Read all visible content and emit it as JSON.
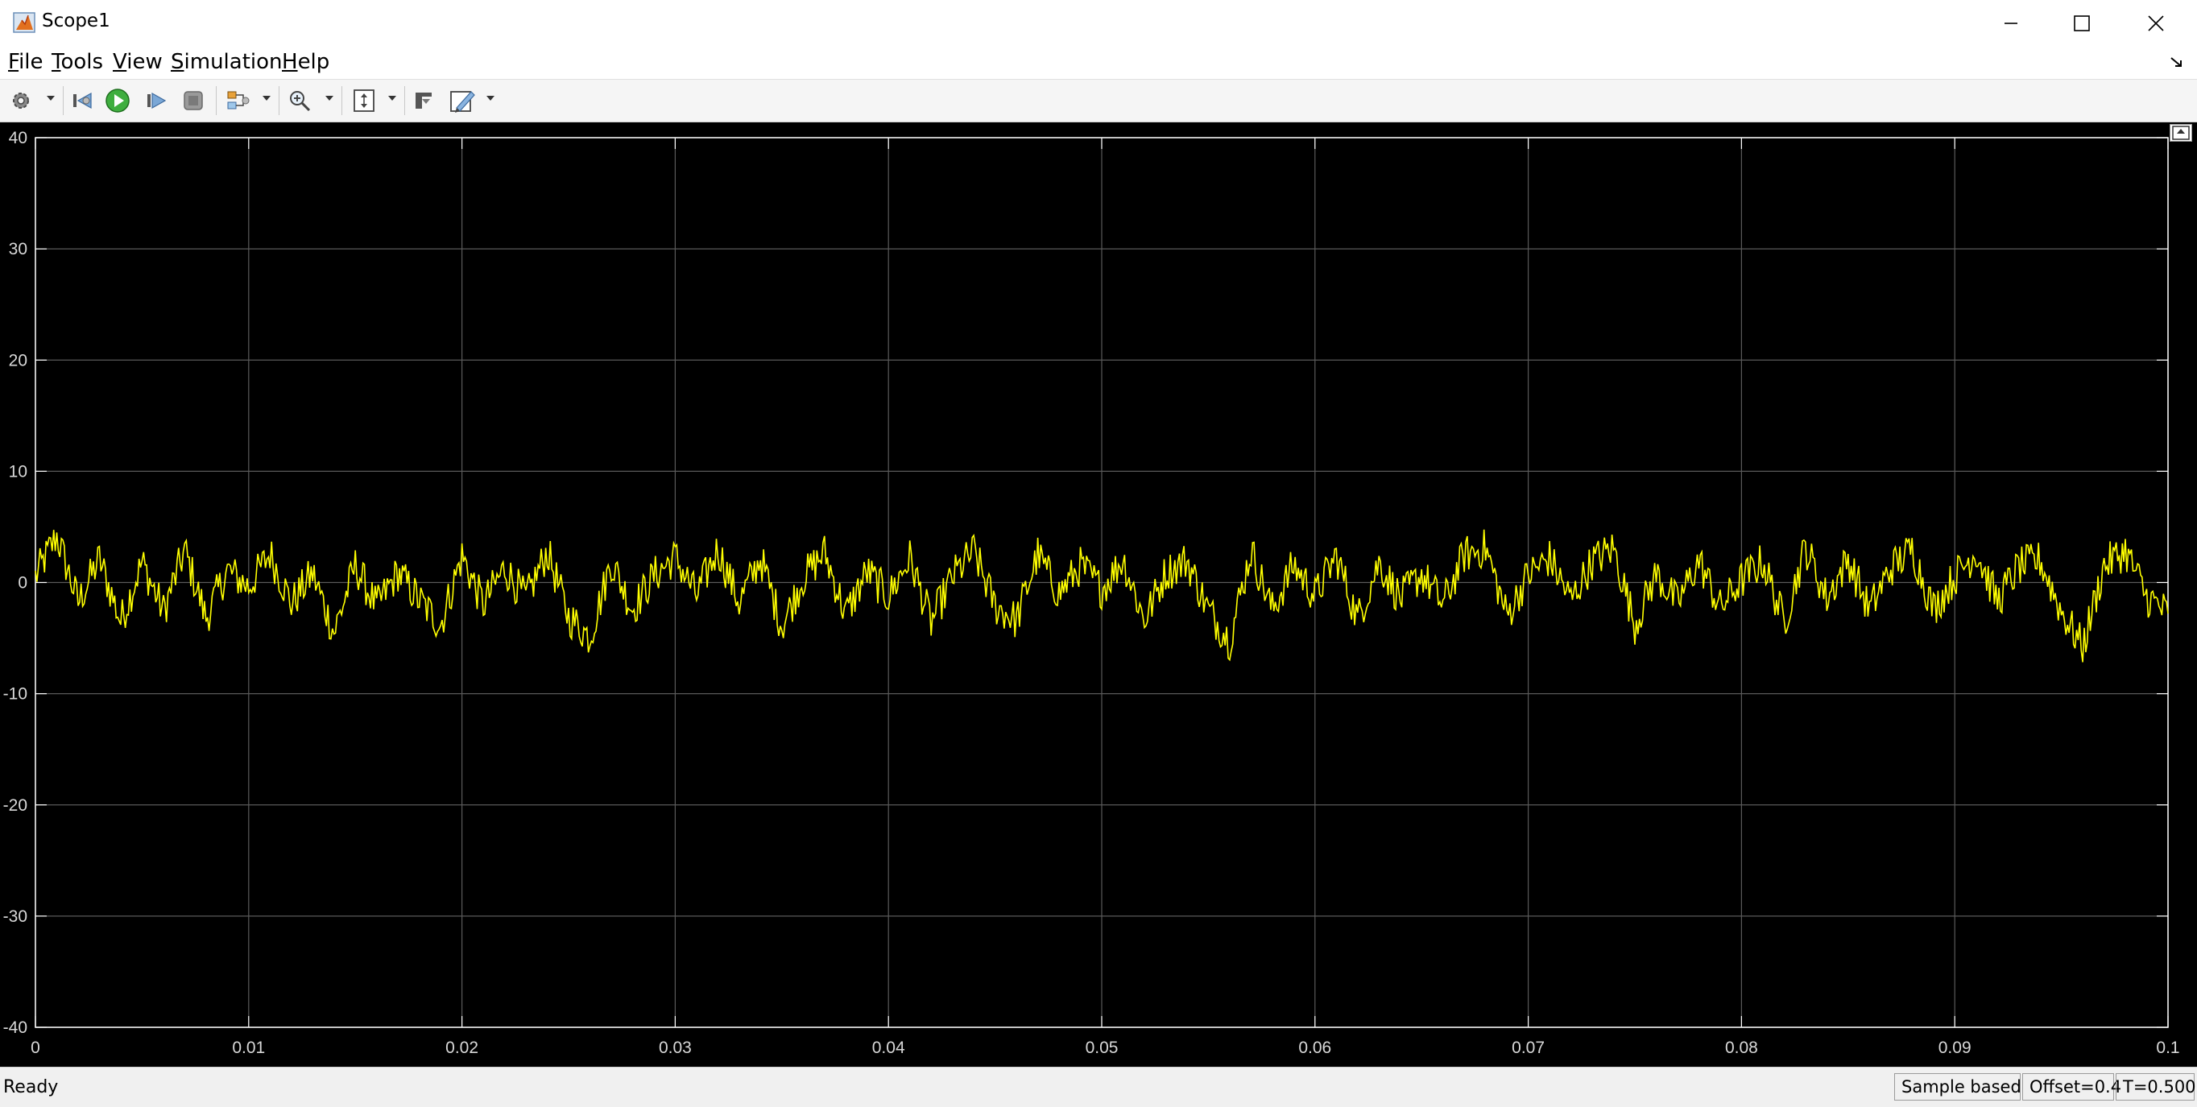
{
  "window": {
    "title": "Scope1",
    "controls": [
      "minimize-icon",
      "maximize-icon",
      "close-icon"
    ]
  },
  "menu": {
    "items": [
      "File",
      "Tools",
      "View",
      "Simulation",
      "Help"
    ]
  },
  "toolbar": {
    "icons": [
      "settings-gear-icon",
      "step-back-icon",
      "run-icon",
      "step-forward-icon",
      "stop-icon",
      "signal-tools-icon",
      "zoom-icon",
      "scale-axes-icon",
      "highlight-block-icon",
      "style-edit-icon"
    ]
  },
  "chart_data": {
    "type": "line",
    "xlim": [
      0,
      0.1
    ],
    "ylim": [
      -40,
      40
    ],
    "x_ticks": [
      "0",
      "0.01",
      "0.02",
      "0.03",
      "0.04",
      "0.05",
      "0.06",
      "0.07",
      "0.08",
      "0.09",
      "0.1"
    ],
    "y_ticks": [
      "40",
      "30",
      "20",
      "10",
      "0",
      "-10",
      "-20",
      "-30",
      "-40"
    ],
    "grid": true,
    "background": "#000000",
    "axes_color": "#ffffff",
    "series": [
      {
        "color": "#ffff00",
        "x": [
          0,
          0.001,
          0.002,
          0.003,
          0.004,
          0.005,
          0.006,
          0.007,
          0.008,
          0.009,
          0.01,
          0.011,
          0.012,
          0.013,
          0.014,
          0.015,
          0.016,
          0.017,
          0.018,
          0.019,
          0.02,
          0.021,
          0.022,
          0.023,
          0.024,
          0.025,
          0.026,
          0.027,
          0.028,
          0.029,
          0.03,
          0.031,
          0.032,
          0.033,
          0.034,
          0.035,
          0.036,
          0.037,
          0.038,
          0.039,
          0.04,
          0.041,
          0.042,
          0.043,
          0.044,
          0.045,
          0.046,
          0.047,
          0.048,
          0.049,
          0.05,
          0.051,
          0.052,
          0.053,
          0.054,
          0.055,
          0.056,
          0.057,
          0.058,
          0.059,
          0.06,
          0.061,
          0.062,
          0.063,
          0.064,
          0.065,
          0.066,
          0.067,
          0.068,
          0.069,
          0.07,
          0.071,
          0.072,
          0.073,
          0.074,
          0.075,
          0.076,
          0.077,
          0.078,
          0.079,
          0.08,
          0.081,
          0.082,
          0.083,
          0.084,
          0.085,
          0.086,
          0.087,
          0.088,
          0.089,
          0.09,
          0.091,
          0.092,
          0.093,
          0.094,
          0.095,
          0.096,
          0.097,
          0.098,
          0.099,
          0.1
        ],
        "y": [
          0.5,
          4.2,
          -1.8,
          2.1,
          -3.5,
          1.8,
          -2.6,
          2.9,
          -3.2,
          1.1,
          -0.4,
          2.6,
          -1.9,
          0.8,
          -4.5,
          1.5,
          -2.2,
          0.9,
          -1.6,
          -3.8,
          2.4,
          -2.0,
          1.3,
          -1.5,
          2.8,
          -3.1,
          -4.9,
          1.9,
          -2.4,
          0.6,
          2.3,
          -1.2,
          3.0,
          -1.8,
          2.2,
          -3.9,
          0.4,
          2.7,
          -2.9,
          1.0,
          -1.3,
          2.2,
          -3.6,
          0.5,
          2.8,
          -2.1,
          -3.4,
          2.5,
          -1.0,
          1.5,
          -0.6,
          2.1,
          -3.4,
          0.9,
          2.0,
          -2.5,
          -5.2,
          2.9,
          -2.5,
          1.6,
          -1.2,
          2.4,
          -3.3,
          1.8,
          -1.5,
          0.8,
          -2.0,
          2.5,
          3.1,
          -3.0,
          0.7,
          2.2,
          -1.6,
          1.9,
          3.1,
          -3.8,
          0.8,
          -1.9,
          2.0,
          -2.3,
          0.2,
          1.9,
          -3.6,
          3.2,
          -1.4,
          2.1,
          -2.5,
          1.3,
          3.0,
          -2.4,
          0.5,
          2.8,
          -1.7,
          1.4,
          2.0,
          -2.6,
          -5.8,
          1.5,
          2.9,
          -1.3,
          -2.8
        ]
      }
    ]
  },
  "status": {
    "left": "Ready",
    "mode": "Sample based",
    "offset": "Offset=0.4",
    "time": "T=0.500"
  }
}
